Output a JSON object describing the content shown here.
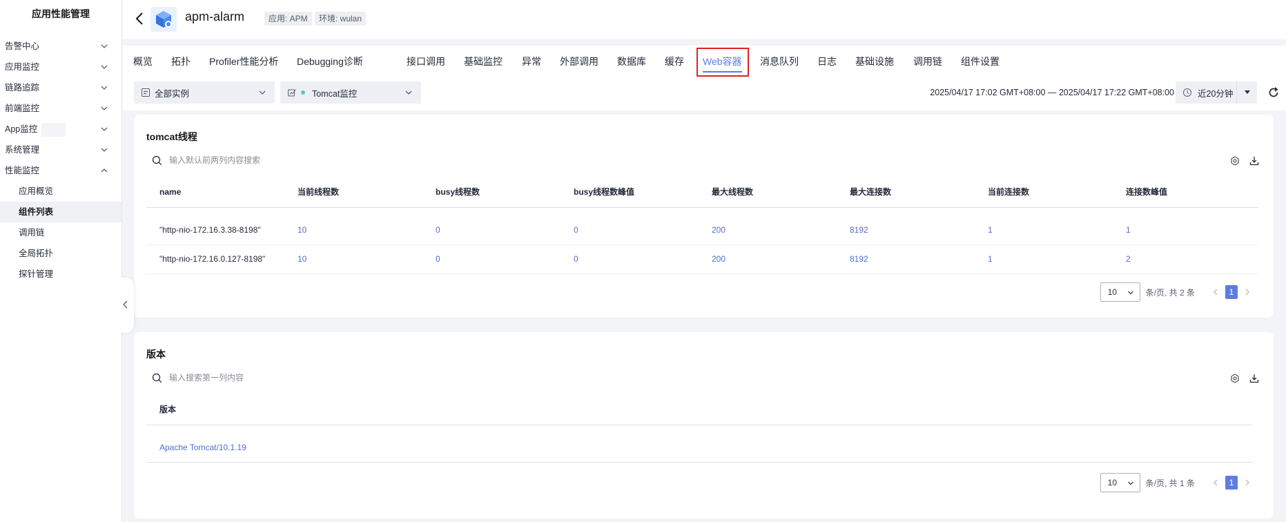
{
  "sidebar": {
    "title": "应用性能管理",
    "items": [
      {
        "label": "告警中心",
        "expanded": false
      },
      {
        "label": "应用监控",
        "expanded": false
      },
      {
        "label": "链路追踪",
        "expanded": false
      },
      {
        "label": "前端监控",
        "expanded": false
      },
      {
        "label": "App监控",
        "expanded": false
      },
      {
        "label": "系统管理",
        "expanded": false
      },
      {
        "label": "性能监控",
        "expanded": true
      }
    ],
    "subitems": [
      {
        "label": "应用概览",
        "active": false
      },
      {
        "label": "组件列表",
        "active": true
      },
      {
        "label": "调用链",
        "active": false
      },
      {
        "label": "全局拓扑",
        "active": false
      },
      {
        "label": "探针管理",
        "active": false
      }
    ]
  },
  "header": {
    "app_name": "apm-alarm",
    "tag_app": "应用: APM",
    "tag_env": "环境: wulan"
  },
  "tabs": [
    {
      "label": "概览",
      "active": false
    },
    {
      "label": "拓扑",
      "active": false
    },
    {
      "label": "Profiler性能分析",
      "active": false
    },
    {
      "label": "Debugging诊断",
      "active": false
    },
    {
      "label": "接口调用",
      "active": false
    },
    {
      "label": "基础监控",
      "active": false
    },
    {
      "label": "异常",
      "active": false
    },
    {
      "label": "外部调用",
      "active": false
    },
    {
      "label": "数据库",
      "active": false
    },
    {
      "label": "缓存",
      "active": false
    },
    {
      "label": "Web容器",
      "active": true
    },
    {
      "label": "消息队列",
      "active": false
    },
    {
      "label": "日志",
      "active": false
    },
    {
      "label": "基础设施",
      "active": false
    },
    {
      "label": "调用链",
      "active": false
    },
    {
      "label": "组件设置",
      "active": false
    }
  ],
  "filters": {
    "instance_select": "全部实例",
    "monitor_select": "Tomcat监控",
    "time_range": "2025/04/17 17:02 GMT+08:00 — 2025/04/17 17:22 GMT+08:00",
    "time_picker": "近20分钟"
  },
  "threads_card": {
    "title": "tomcat线程",
    "search_placeholder": "输入默认前两列内容搜索",
    "columns": [
      "name",
      "当前线程数",
      "busy线程数",
      "busy线程数峰值",
      "最大线程数",
      "最大连接数",
      "当前连接数",
      "连接数峰值"
    ],
    "rows": [
      [
        "\"http-nio-172.16.3.38-8198\"",
        "10",
        "0",
        "0",
        "200",
        "8192",
        "1",
        "1"
      ],
      [
        "\"http-nio-172.16.0.127-8198\"",
        "10",
        "0",
        "0",
        "200",
        "8192",
        "1",
        "2"
      ]
    ],
    "page_size": "10",
    "total_text": "条/页,  共 2 条",
    "current_page": "1"
  },
  "version_card": {
    "title": "版本",
    "search_placeholder": "输入搜索第一列内容",
    "columns": [
      "版本"
    ],
    "rows": [
      [
        "Apache Tomcat/10.1.19"
      ]
    ],
    "page_size": "10",
    "total_text": "条/页,  共 1 条",
    "current_page": "1"
  },
  "colors": {
    "accent": "#5e7ce0",
    "link": "#526ecc",
    "highlight_box": "#e02020"
  }
}
